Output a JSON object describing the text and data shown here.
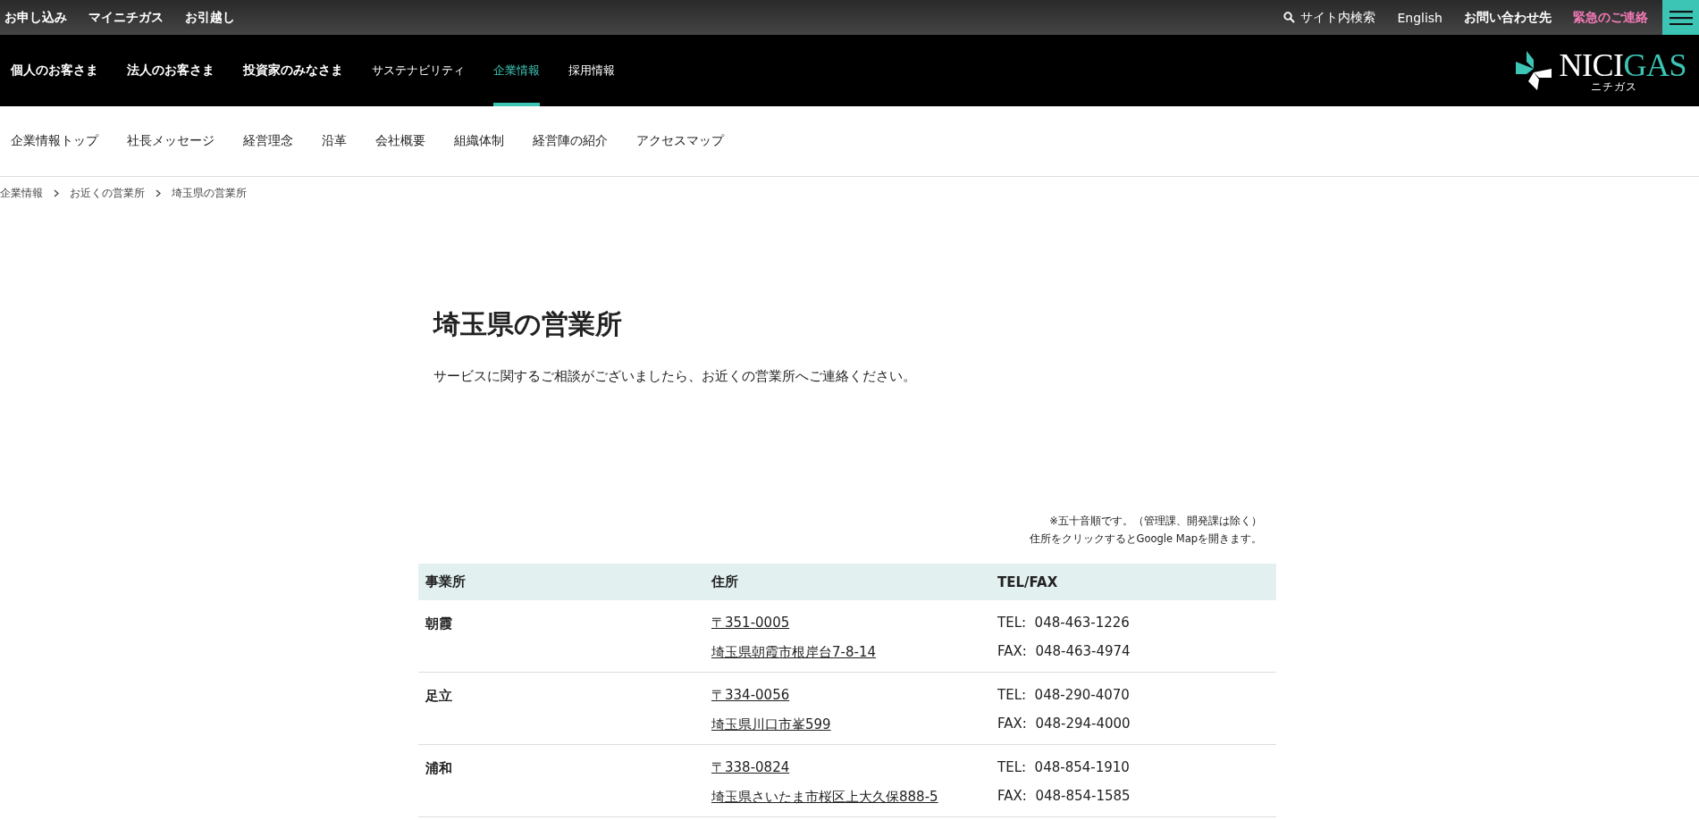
{
  "utility_bar": {
    "left_links": [
      "お申し込み",
      "マイニチガス",
      "お引越し"
    ],
    "right_links": [
      {
        "label": "サイト内検索",
        "kind": "search"
      },
      {
        "label": "English",
        "kind": "plain"
      },
      {
        "label": "お問い合わせ先",
        "kind": "bold"
      },
      {
        "label": "緊急のご連絡",
        "kind": "emergency"
      }
    ]
  },
  "main_nav": {
    "items": [
      {
        "label": "個人のお客さま",
        "kind": "primary",
        "selected": false
      },
      {
        "label": "法人のお客さま",
        "kind": "primary",
        "selected": false
      },
      {
        "label": "投資家のみなさま",
        "kind": "primary",
        "selected": false
      },
      {
        "label": "サステナビリティ",
        "kind": "secondary",
        "selected": false
      },
      {
        "label": "企業情報",
        "kind": "secondary",
        "selected": true
      },
      {
        "label": "採用情報",
        "kind": "secondary",
        "selected": false
      }
    ],
    "logo": {
      "main": "NICI",
      "accent": "GAS",
      "reading": "ニチガス"
    }
  },
  "sub_nav": [
    "企業情報トップ",
    "社長メッセージ",
    "経営理念",
    "沿革",
    "会社概要",
    "組織体制",
    "経営陣の紹介",
    "アクセスマップ"
  ],
  "breadcrumb": [
    "企業情報",
    "お近くの営業所",
    "埼玉県の営業所"
  ],
  "page": {
    "title": "埼玉県の営業所",
    "lead": "サービスに関するご相談がございましたら、お近くの営業所へご連絡ください。"
  },
  "notes": [
    "※五十音順です。（管理課、開発課は除く）",
    "住所をクリックするとGoogle Mapを開きます。"
  ],
  "table": {
    "columns": [
      "事業所",
      "住所",
      "TEL/FAX"
    ],
    "rows": [
      {
        "office": "朝霞",
        "postal": "〒351-0005",
        "address": "埼玉県朝霞市根岸台7-8-14",
        "tel_label": "TEL:",
        "tel": "048-463-1226",
        "fax_label": "FAX:",
        "fax": "048-463-4974"
      },
      {
        "office": "足立",
        "postal": "〒334-0056",
        "address": "埼玉県川口市峯599",
        "tel_label": "TEL:",
        "tel": "048-290-4070",
        "fax_label": "FAX:",
        "fax": "048-294-4000"
      },
      {
        "office": "浦和",
        "postal": "〒338-0824",
        "address": "埼玉県さいたま市桜区上大久保888-5",
        "tel_label": "TEL:",
        "tel": "048-854-1910",
        "fax_label": "FAX:",
        "fax": "048-854-1585"
      }
    ]
  }
}
